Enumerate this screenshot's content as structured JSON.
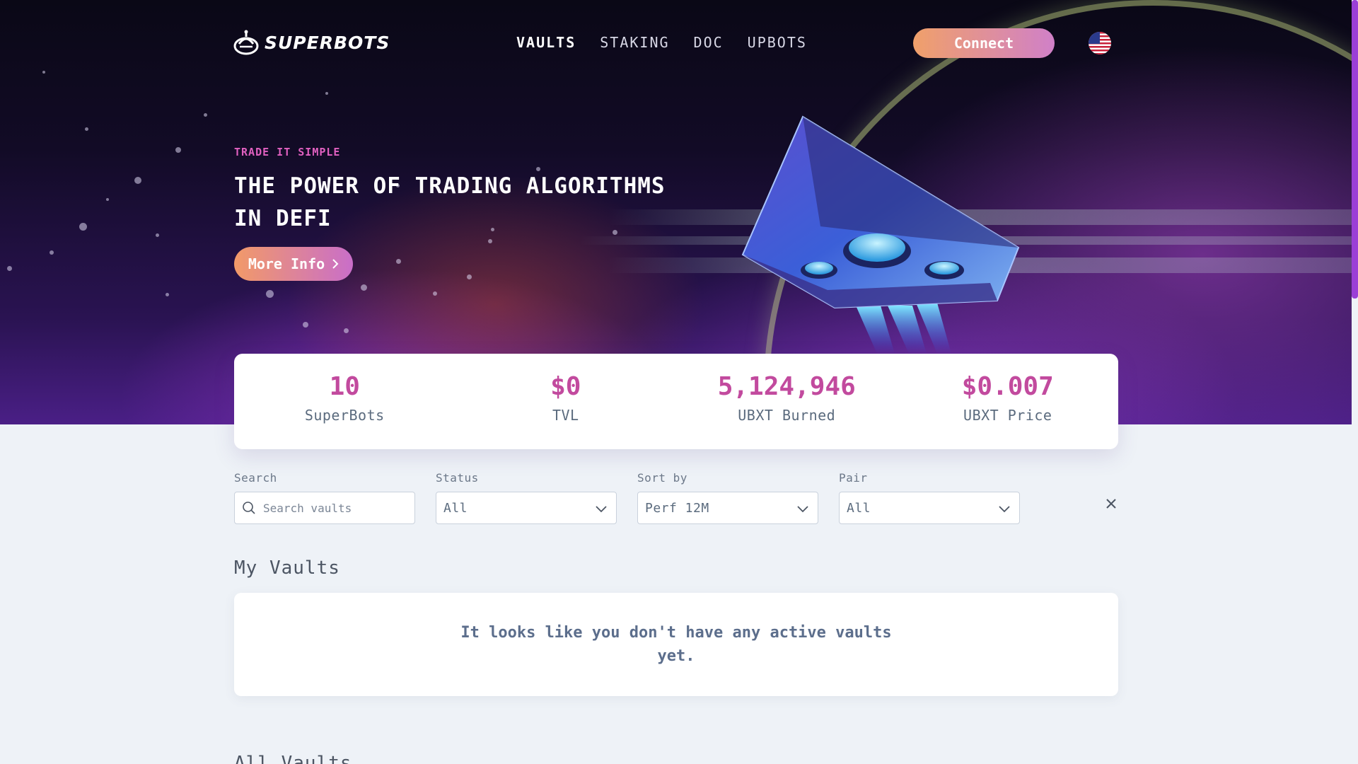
{
  "brand": {
    "name": "SUPERBOTS"
  },
  "nav": {
    "links": [
      "VAULTS",
      "STAKING",
      "DOC",
      "UPBOTS"
    ],
    "active": "VAULTS",
    "connect_label": "Connect"
  },
  "hero": {
    "kicker": "TRADE IT SIMPLE",
    "headline_line1": "THE POWER OF TRADING ALGORITHMS",
    "headline_line2": "IN DEFI",
    "more_info_label": "More Info"
  },
  "stats": [
    {
      "value": "10",
      "label": "SuperBots"
    },
    {
      "value": "$0",
      "label": "TVL"
    },
    {
      "value": "5,124,946",
      "label": "UBXT Burned"
    },
    {
      "value": "$0.007",
      "label": "UBXT Price"
    }
  ],
  "filters": {
    "search": {
      "label": "Search",
      "placeholder": "Search vaults"
    },
    "status": {
      "label": "Status",
      "value": "All"
    },
    "sort": {
      "label": "Sort by",
      "value": "Perf 12M"
    },
    "pair": {
      "label": "Pair",
      "value": "All"
    }
  },
  "my_vaults": {
    "title": "My Vaults",
    "empty_message": "It looks like you don't have any active vaults yet."
  },
  "all_vaults": {
    "title": "All Vaults"
  },
  "colors": {
    "accent": "#c24a9e",
    "hero_bg": "#120b26",
    "page_bg": "#eef2f7"
  }
}
